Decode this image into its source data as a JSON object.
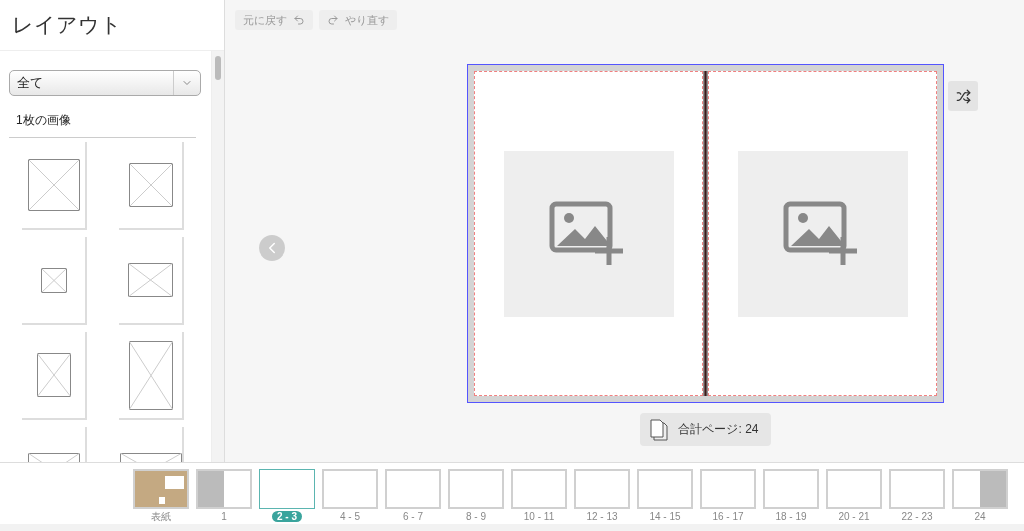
{
  "sidebar": {
    "title": "レイアウト",
    "filter": {
      "value": "全て"
    },
    "section": "1枚の画像"
  },
  "toolbar": [
    {
      "kind": "undo",
      "label": "元に戻す",
      "disabled": true
    },
    {
      "kind": "redo",
      "label": "やり直す",
      "disabled": true
    }
  ],
  "page_count": {
    "label": "合計ページ:",
    "value": "24"
  },
  "thumbnails": [
    {
      "kind": "cover",
      "label": "表紙",
      "selected": false
    },
    {
      "kind": "left-blank",
      "label": "1",
      "selected": false
    },
    {
      "kind": "spread",
      "label": "2 - 3",
      "selected": true
    },
    {
      "kind": "spread",
      "label": "4 - 5",
      "selected": false
    },
    {
      "kind": "spread",
      "label": "6 - 7",
      "selected": false
    },
    {
      "kind": "spread",
      "label": "8 - 9",
      "selected": false
    },
    {
      "kind": "spread",
      "label": "10 - 11",
      "selected": false
    },
    {
      "kind": "spread",
      "label": "12 - 13",
      "selected": false
    },
    {
      "kind": "spread",
      "label": "14 - 15",
      "selected": false
    },
    {
      "kind": "spread",
      "label": "16 - 17",
      "selected": false
    },
    {
      "kind": "spread",
      "label": "18 - 19",
      "selected": false
    },
    {
      "kind": "spread",
      "label": "20 - 21",
      "selected": false
    },
    {
      "kind": "spread",
      "label": "22 - 23",
      "selected": false
    },
    {
      "kind": "right-blank",
      "label": "24",
      "selected": false
    }
  ]
}
